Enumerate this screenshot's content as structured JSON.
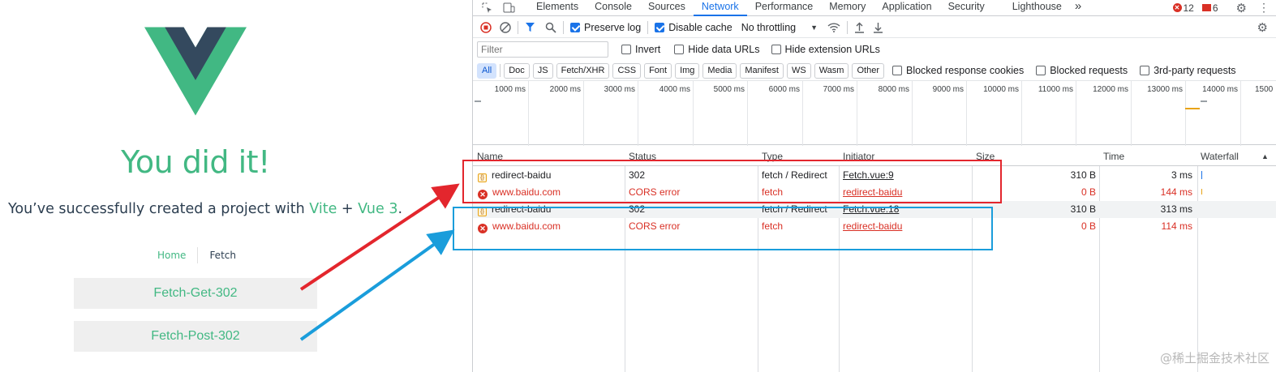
{
  "app": {
    "heading": "You did it!",
    "subtitle_prefix": "You’ve successfully created a project with ",
    "subtitle_vite": "Vite",
    "subtitle_plus": " + ",
    "subtitle_vue": "Vue 3",
    "subtitle_suffix": ".",
    "nav": {
      "home": "Home",
      "fetch": "Fetch"
    },
    "buttons": {
      "get": "Fetch-Get-302",
      "post": "Fetch-Post-302"
    },
    "colors": {
      "green": "#42b883",
      "dark": "#35495e"
    }
  },
  "devtools": {
    "tabs": [
      "Elements",
      "Console",
      "Sources",
      "Network",
      "Performance",
      "Memory",
      "Application",
      "Security",
      "Lighthouse"
    ],
    "active_tab": "Network",
    "more_tabs": "»",
    "error_count": "12",
    "warning_count": "6",
    "toolbar": {
      "preserve_log": "Preserve log",
      "disable_cache": "Disable cache",
      "throttling": "No throttling"
    },
    "filter": {
      "placeholder": "Filter",
      "invert": "Invert",
      "hide_data_urls": "Hide data URLs",
      "hide_extension_urls": "Hide extension URLs"
    },
    "type_filters": [
      "All",
      "Doc",
      "JS",
      "Fetch/XHR",
      "CSS",
      "Font",
      "Img",
      "Media",
      "Manifest",
      "WS",
      "Wasm",
      "Other"
    ],
    "blocked_response_cookies": "Blocked response cookies",
    "blocked_requests": "Blocked requests",
    "third_party_requests": "3rd-party requests",
    "timeline_ticks": [
      "1000 ms",
      "2000 ms",
      "3000 ms",
      "4000 ms",
      "5000 ms",
      "6000 ms",
      "7000 ms",
      "8000 ms",
      "9000 ms",
      "10000 ms",
      "11000 ms",
      "12000 ms",
      "13000 ms",
      "14000 ms",
      "1500"
    ],
    "columns": {
      "name": "Name",
      "status": "Status",
      "type": "Type",
      "initiator": "Initiator",
      "size": "Size",
      "time": "Time",
      "waterfall": "Waterfall"
    },
    "requests": [
      {
        "name": "redirect-baidu",
        "status": "302",
        "type": "fetch / Redirect",
        "initiator": "Fetch.vue:9",
        "size": "310 B",
        "time": "3 ms",
        "error": false
      },
      {
        "name": "www.baidu.com",
        "status": "CORS error",
        "type": "fetch",
        "initiator": "redirect-baidu",
        "size": "0 B",
        "time": "144 ms",
        "error": true
      },
      {
        "name": "redirect-baidu",
        "status": "302",
        "type": "fetch / Redirect",
        "initiator": "Fetch.vue:18",
        "size": "310 B",
        "time": "313 ms",
        "error": false
      },
      {
        "name": "www.baidu.com",
        "status": "CORS error",
        "type": "fetch",
        "initiator": "redirect-baidu",
        "size": "0 B",
        "time": "114 ms",
        "error": true
      }
    ]
  },
  "annotations": {
    "red": "#e3262d",
    "blue": "#1a9ddb"
  },
  "watermark": "@稀土掘金技术社区"
}
